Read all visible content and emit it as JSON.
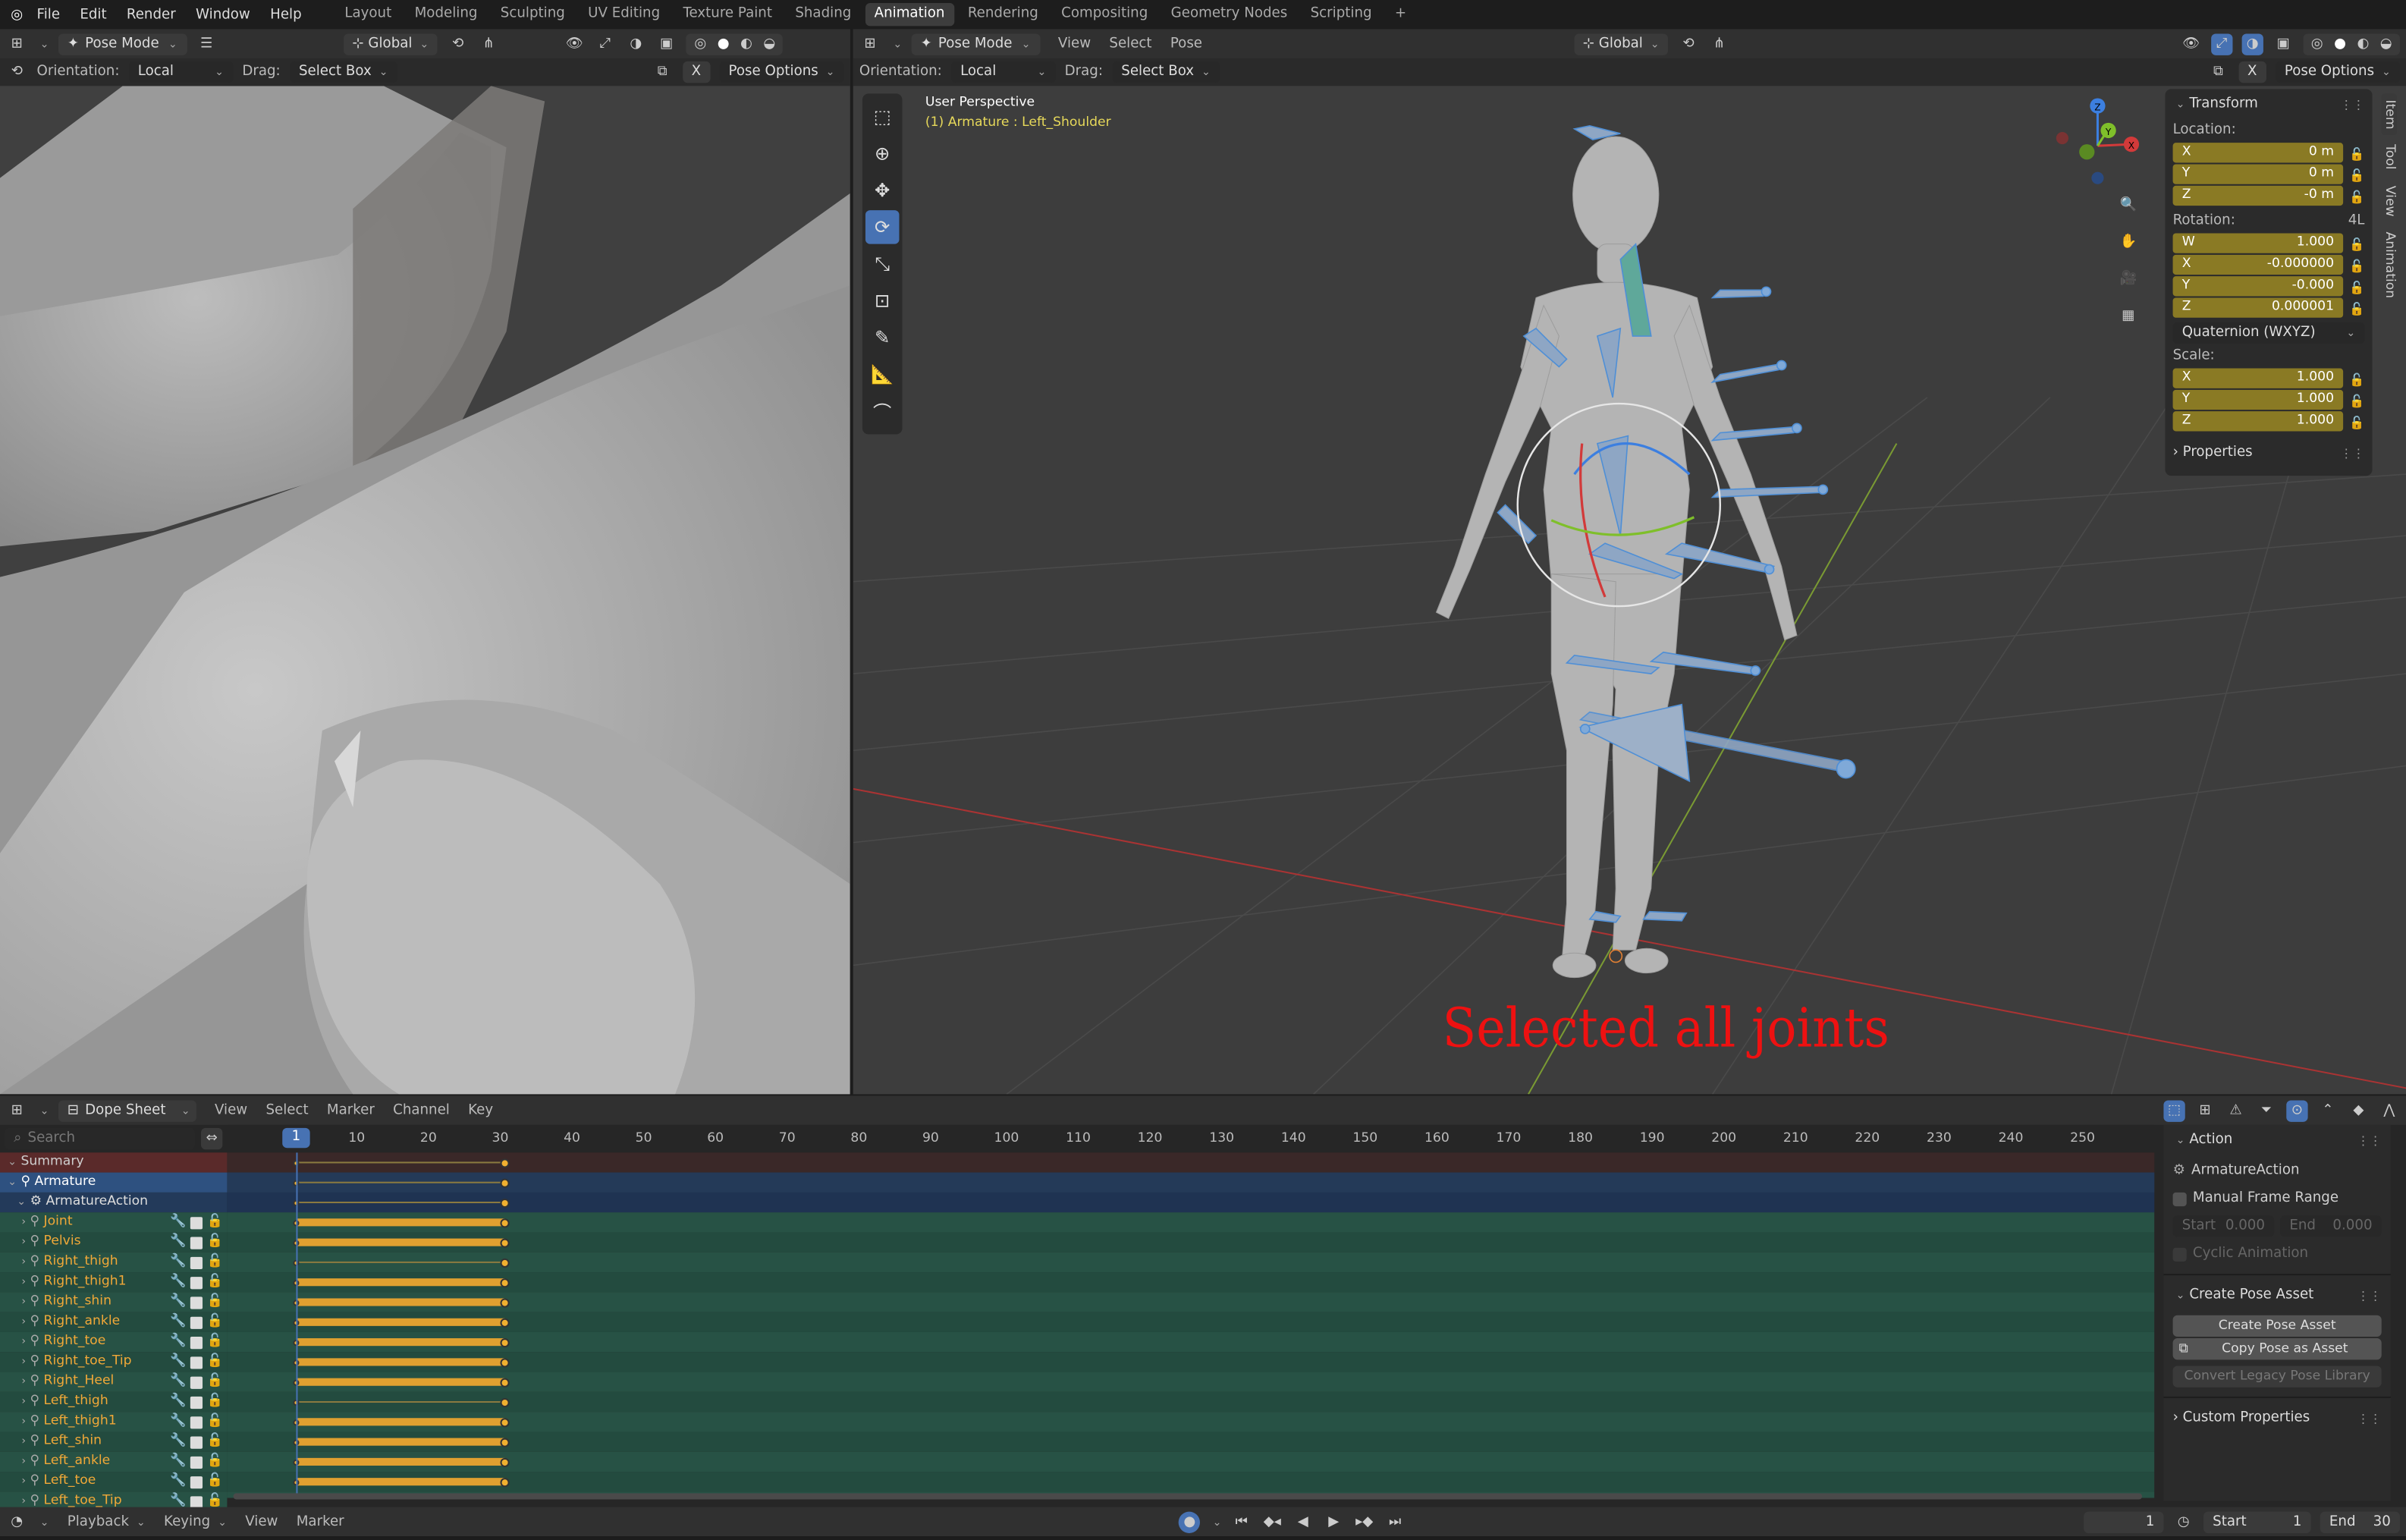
{
  "menu": {
    "file": "File",
    "edit": "Edit",
    "render": "Render",
    "window": "Window",
    "help": "Help"
  },
  "workspaces": [
    "Layout",
    "Modeling",
    "Sculpting",
    "UV Editing",
    "Texture Paint",
    "Shading",
    "Animation",
    "Rendering",
    "Compositing",
    "Geometry Nodes",
    "Scripting"
  ],
  "workspace_plus": "+",
  "left_view": {
    "mode": "Pose Mode",
    "transform_orientation": "Global",
    "orientation_label": "Orientation:",
    "orientation_value": "Local",
    "drag_label": "Drag:",
    "drag_value": "Select Box",
    "pose_options": "Pose Options",
    "x_label": "X"
  },
  "right_view": {
    "mode": "Pose Mode",
    "menus": [
      "View",
      "Select",
      "Pose"
    ],
    "transform_orientation": "Global",
    "orientation_label": "Orientation:",
    "orientation_value": "Local",
    "drag_label": "Drag:",
    "drag_value": "Select Box",
    "pose_options": "Pose Options",
    "x_label": "X",
    "overlay_title": "User Perspective",
    "overlay_subtitle": "(1) Armature : Left_Shoulder",
    "annotation": "Selected all joints",
    "gizmo_axes": {
      "x": "X",
      "y": "Y",
      "z": "Z"
    }
  },
  "npanel": {
    "tabs": [
      "Item",
      "Tool",
      "View",
      "Animation"
    ],
    "transform_title": "Transform",
    "location_label": "Location:",
    "location": [
      {
        "axis": "X",
        "value": "0 m"
      },
      {
        "axis": "Y",
        "value": "0 m"
      },
      {
        "axis": "Z",
        "value": "-0 m"
      }
    ],
    "rotation_label": "Rotation:",
    "rotation_mode_tag": "4L",
    "rotation": [
      {
        "axis": "W",
        "value": "1.000"
      },
      {
        "axis": "X",
        "value": "-0.000000"
      },
      {
        "axis": "Y",
        "value": "-0.000"
      },
      {
        "axis": "Z",
        "value": "0.000001"
      }
    ],
    "rotation_mode": "Quaternion (WXYZ)",
    "scale_label": "Scale:",
    "scale": [
      {
        "axis": "X",
        "value": "1.000"
      },
      {
        "axis": "Y",
        "value": "1.000"
      },
      {
        "axis": "Z",
        "value": "1.000"
      }
    ],
    "properties": "Properties"
  },
  "dopesheet": {
    "mode": "Dope Sheet",
    "menus": [
      "View",
      "Select",
      "Marker",
      "Channel",
      "Key"
    ],
    "search_placeholder": "Search",
    "current_frame": "1",
    "ticks": [
      "10",
      "20",
      "30",
      "40",
      "50",
      "60",
      "70",
      "80",
      "90",
      "100",
      "110",
      "120",
      "130",
      "140",
      "150",
      "160",
      "170",
      "180",
      "190",
      "200",
      "210",
      "220",
      "230",
      "240",
      "250"
    ],
    "summary": "Summary",
    "armature": "Armature",
    "action": "ArmatureAction",
    "channels": [
      "Joint",
      "Pelvis",
      "Right_thigh",
      "Right_thigh1",
      "Right_shin",
      "Right_ankle",
      "Right_toe",
      "Right_toe_Tip",
      "Right_Heel",
      "Left_thigh",
      "Left_thigh1",
      "Left_shin",
      "Left_ankle",
      "Left_toe",
      "Left_toe_Tip"
    ],
    "keyframes": [
      1,
      30
    ],
    "held_channels": [
      0,
      1,
      3,
      4,
      5,
      6,
      7,
      8,
      10,
      11,
      12,
      13
    ]
  },
  "action_panel": {
    "title": "Action",
    "action_name": "ArmatureAction",
    "manual_frame_range": "Manual Frame Range",
    "start_label": "Start",
    "start_value": "0.000",
    "end_label": "End",
    "end_value": "0.000",
    "cyclic": "Cyclic Animation",
    "pose_asset_title": "Create Pose Asset",
    "create_btn": "Create Pose Asset",
    "copy_btn": "Copy Pose as Asset",
    "convert_btn": "Convert Legacy Pose Library",
    "custom_props": "Custom Properties"
  },
  "timeline": {
    "menus": [
      "Playback",
      "Keying",
      "View",
      "Marker"
    ],
    "frame": "1",
    "start_label": "Start",
    "start": "1",
    "end_label": "End",
    "end": "30"
  }
}
